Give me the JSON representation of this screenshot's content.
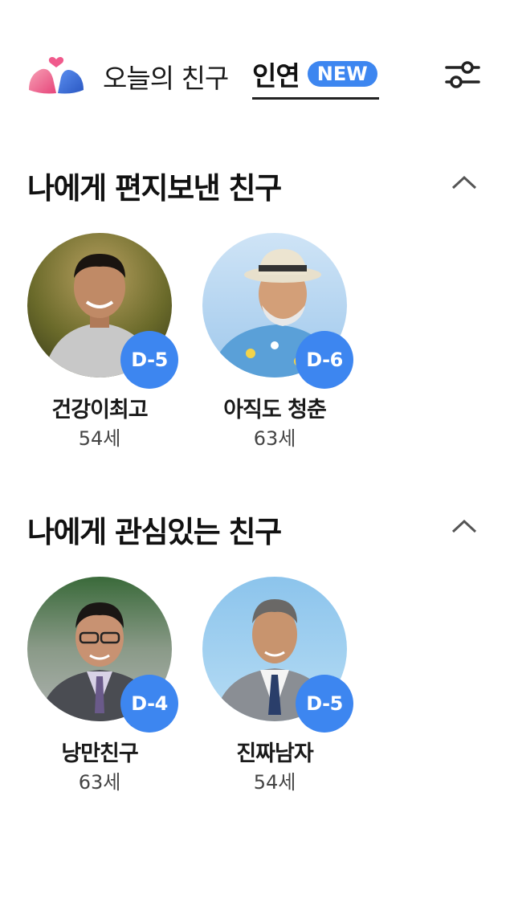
{
  "header": {
    "tab_today": "오늘의 친구",
    "tab_inyeon": "인연",
    "new_badge": "NEW"
  },
  "sections": [
    {
      "title": "나에게 편지보낸 친구",
      "friends": [
        {
          "name": "건강이최고",
          "age": "54세",
          "dday": "D-5"
        },
        {
          "name": "아직도 청춘",
          "age": "63세",
          "dday": "D-6"
        }
      ]
    },
    {
      "title": "나에게 관심있는 친구",
      "friends": [
        {
          "name": "낭만친구",
          "age": "63세",
          "dday": "D-4"
        },
        {
          "name": "진짜남자",
          "age": "54세",
          "dday": "D-5"
        }
      ]
    }
  ],
  "colors": {
    "accent": "#3d86f0",
    "logo_pink": "#f05a8c",
    "logo_blue": "#3b6fd6"
  }
}
